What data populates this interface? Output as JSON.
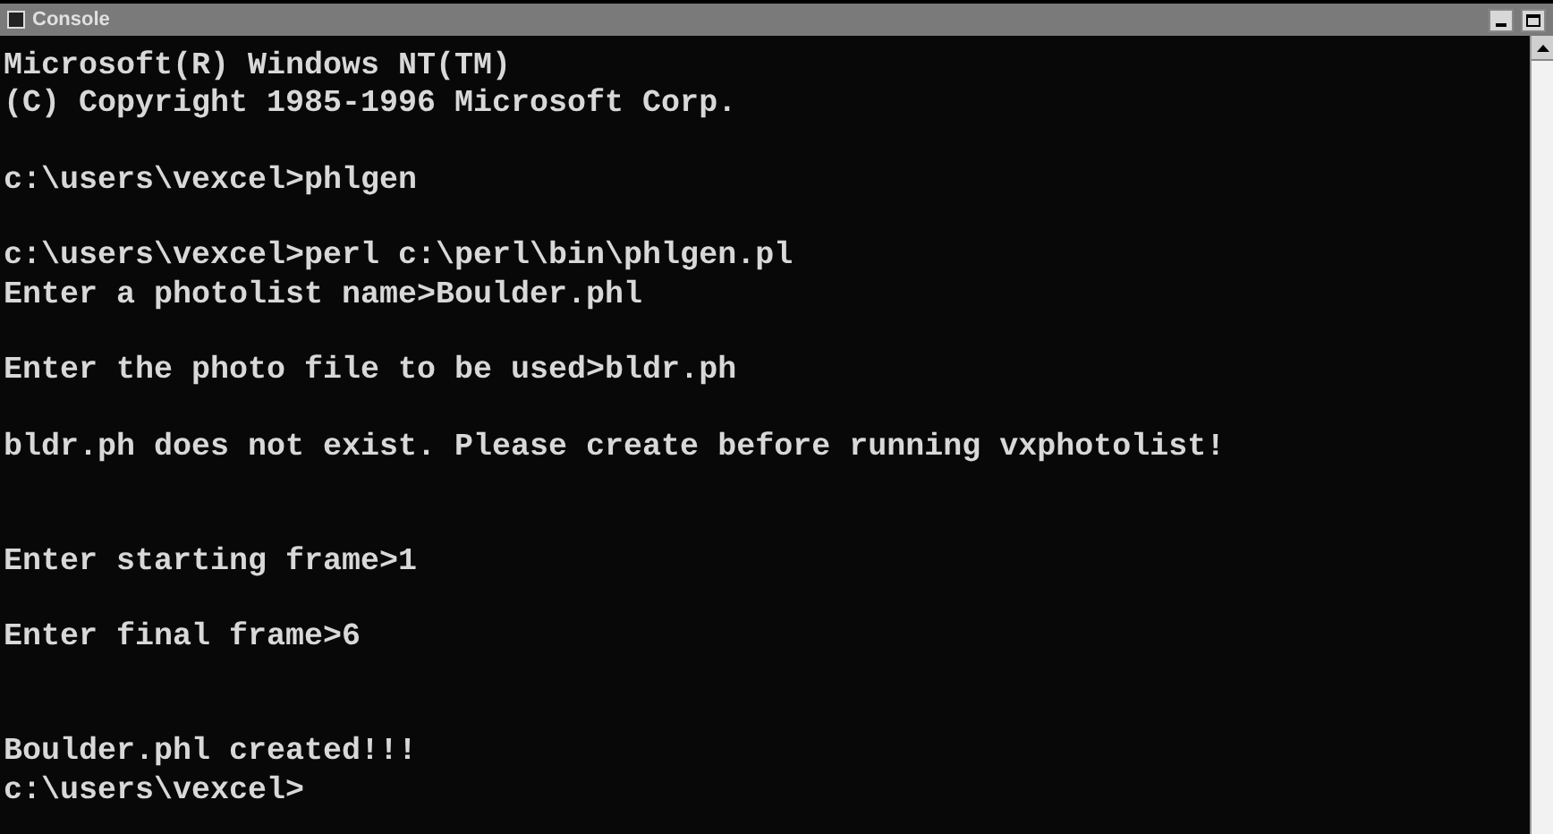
{
  "window": {
    "title": "Console"
  },
  "lines": [
    {
      "kind": "text",
      "text": "Microsoft(R) Windows NT(TM)"
    },
    {
      "kind": "text",
      "text": "(C) Copyright 1985-1996 Microsoft Corp."
    },
    {
      "kind": "blank"
    },
    {
      "kind": "text",
      "text": "c:\\users\\vexcel>phlgen"
    },
    {
      "kind": "blank"
    },
    {
      "kind": "text",
      "text": "c:\\users\\vexcel>perl c:\\perl\\bin\\phlgen.pl"
    },
    {
      "kind": "text",
      "text": "Enter a photolist name>Boulder.phl"
    },
    {
      "kind": "blank"
    },
    {
      "kind": "text",
      "text": "Enter the photo file to be used>bldr.ph"
    },
    {
      "kind": "blank"
    },
    {
      "kind": "text",
      "text": "bldr.ph does not exist. Please create before running vxphotolist!"
    },
    {
      "kind": "blank"
    },
    {
      "kind": "blank"
    },
    {
      "kind": "text",
      "text": "Enter starting frame>1"
    },
    {
      "kind": "blank"
    },
    {
      "kind": "text",
      "text": "Enter final frame>6"
    },
    {
      "kind": "blank"
    },
    {
      "kind": "blank"
    },
    {
      "kind": "text",
      "text": "Boulder.phl created!!!"
    },
    {
      "kind": "text",
      "text": "c:\\users\\vexcel>"
    }
  ]
}
